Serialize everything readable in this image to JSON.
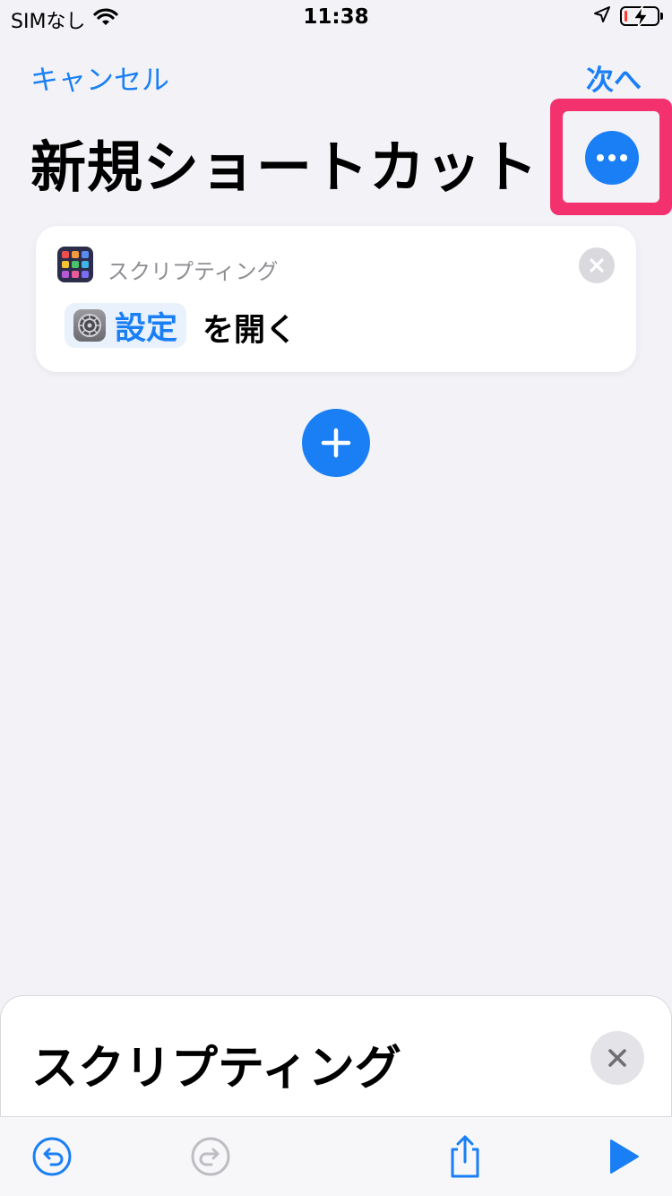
{
  "status_bar": {
    "carrier": "SIMなし",
    "time": "11:38",
    "battery_color": "#ff3b30"
  },
  "nav": {
    "cancel_label": "キャンセル",
    "next_label": "次へ"
  },
  "title": "新規ショートカット",
  "more_button": {
    "icon": "ellipsis-icon",
    "highlight_color": "#f4316f"
  },
  "action_card": {
    "category": "スクリプティング",
    "parameter": "設定",
    "action_text": "を開く",
    "app_icon_colors": [
      "#ef4e4e",
      "#f59a3b",
      "#5a8cf0",
      "#f4c531",
      "#49c46a",
      "#3fb5e8",
      "#b45ad8",
      "#e85a9c",
      "#7a6cf0"
    ]
  },
  "add_button": {
    "icon": "plus-icon"
  },
  "bottom_sheet": {
    "title": "スクリプティング"
  },
  "toolbar": {
    "undo": "undo-icon",
    "redo": "redo-icon",
    "share": "share-icon",
    "play": "play-icon"
  },
  "colors": {
    "accent": "#1a7ff5",
    "background": "#f2f2f7"
  }
}
